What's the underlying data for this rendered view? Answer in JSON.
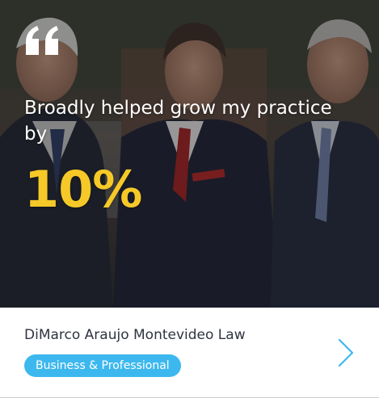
{
  "testimonial": {
    "quote": "Broadly helped grow my practice by",
    "stat": "10%",
    "quote_icon": "quote-icon",
    "photo_subject": "three men in suits"
  },
  "footer": {
    "company": "DiMarco Araujo Montevideo Law",
    "category_tag": "Business & Professional",
    "next_icon": "chevron-right-icon"
  },
  "colors": {
    "stat": "#f6c928",
    "tag_bg": "#3db8ef",
    "chevron": "#3db8ef",
    "company_text": "#2f3440"
  }
}
